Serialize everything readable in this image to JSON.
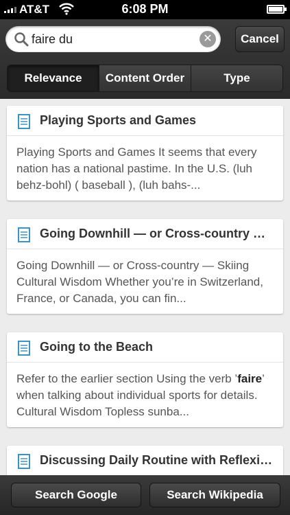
{
  "status_bar": {
    "carrier": "AT&T",
    "time": "6:08 PM"
  },
  "search": {
    "value": "faire du",
    "cancel_label": "Cancel"
  },
  "sort_tabs": [
    {
      "label": "Relevance",
      "active": true
    },
    {
      "label": "Content Order",
      "active": false
    },
    {
      "label": "Type",
      "active": false
    }
  ],
  "results": [
    {
      "title": "Playing Sports and Games",
      "snippet_before": "Playing Sports and Games It seems that every nation has a national pastime. In the U.S. (luh behz-bohl) ( baseball ), (luh bahs-...",
      "highlight": "",
      "snippet_after": ""
    },
    {
      "title": "Going Downhill — or Cross-country —...",
      "snippet_before": "Going Downhill — or Cross-country — Skiing Cultural Wisdom Whether you’re in Switzerland, France, or Canada, you can fin...",
      "highlight": "",
      "snippet_after": ""
    },
    {
      "title": "Going to the Beach",
      "snippet_before": "Refer to the earlier section Using the verb ’",
      "highlight": "faire",
      "snippet_after": "’ when talking about individual sports for details. Cultural Wisdom Topless sunba..."
    },
    {
      "title": "Discussing Daily Routine with Reflexiv...",
      "snippet_before": "",
      "highlight": "",
      "snippet_after": ""
    }
  ],
  "bottom": {
    "google_label": "Search Google",
    "wikipedia_label": "Search Wikipedia"
  }
}
